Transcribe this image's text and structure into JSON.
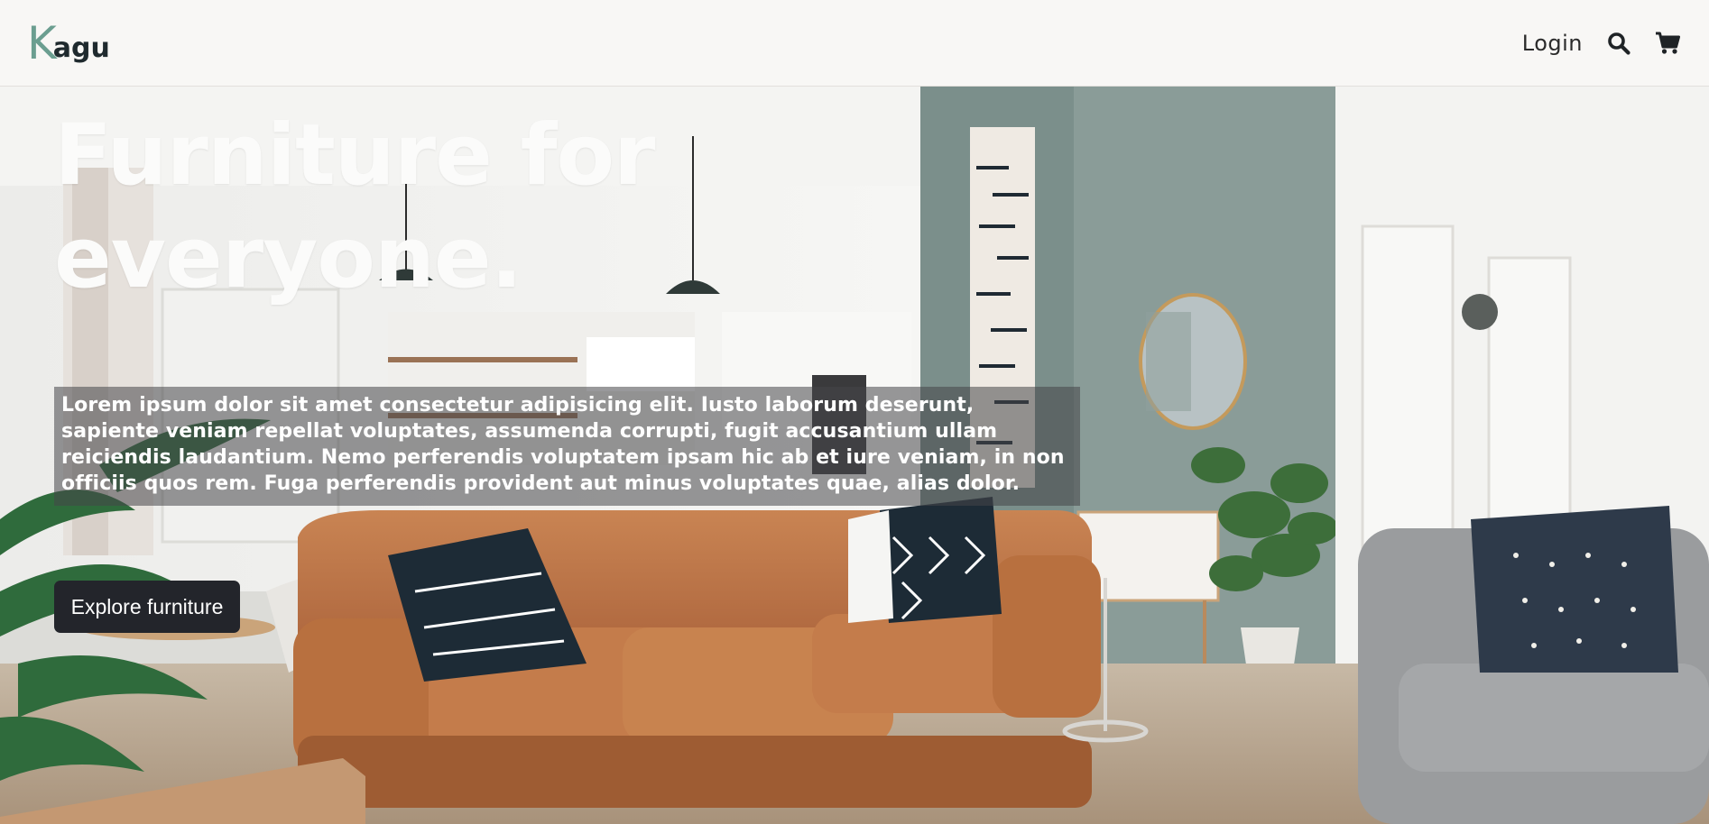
{
  "brand": {
    "logo_initial": "K",
    "logo_rest": "agu",
    "accent_color": "#6b9e90"
  },
  "nav": {
    "login_label": "Login",
    "search_icon": "search-icon",
    "cart_icon": "cart-icon"
  },
  "hero": {
    "title": "Furniture for everyone.",
    "description": "Lorem ipsum dolor sit amet consectetur adipisicing elit. Iusto laborum deserunt, sapiente veniam repellat voluptates, assumenda corrupti, fugit accusantium ullam reiciendis laudantium. Nemo perferendis voluptatem ipsam hic ab et iure veniam, in non officiis quos rem. Fuga perferendis provident aut minus voluptates quae, alias dolor.",
    "cta_label": "Explore furniture",
    "background": "living-room-photo"
  }
}
